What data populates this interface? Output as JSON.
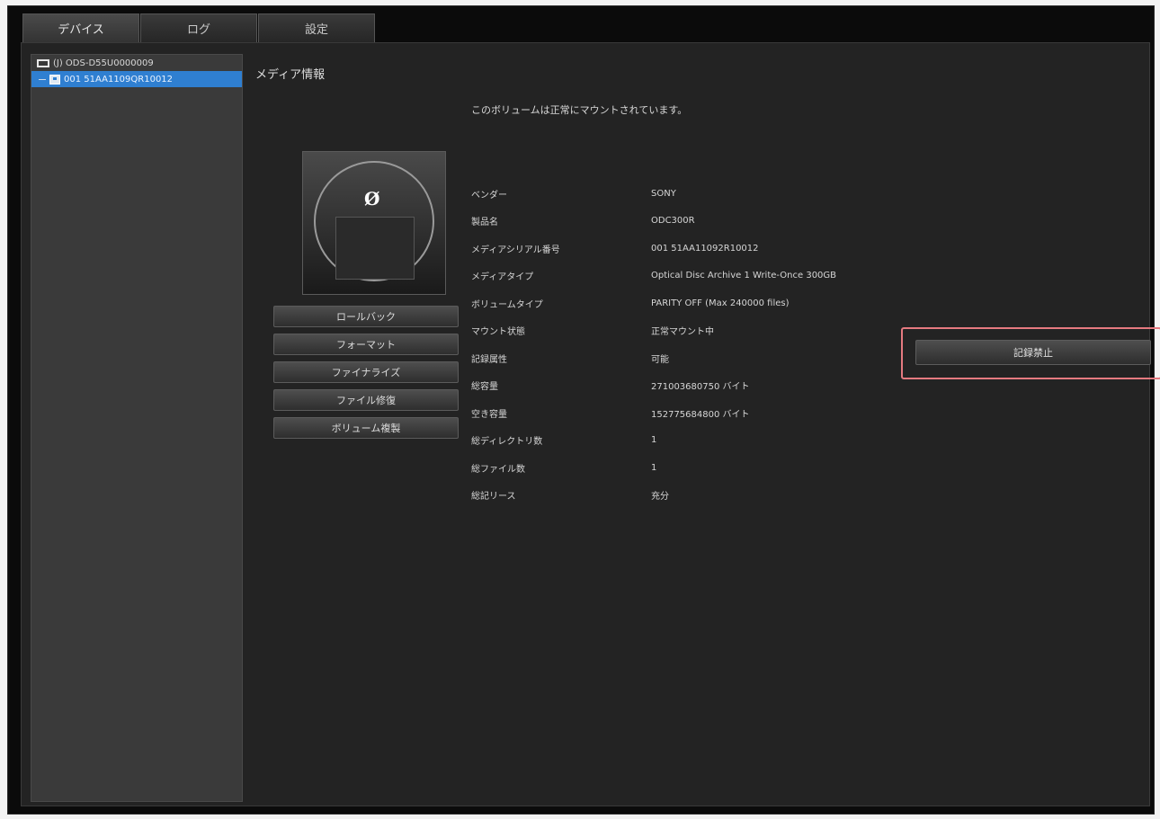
{
  "tabs": [
    {
      "label": "デバイス"
    },
    {
      "label": "ログ"
    },
    {
      "label": "設定"
    }
  ],
  "sidebar": {
    "device": {
      "label": "(J) ODS-D55U0000009"
    },
    "media": {
      "label": "001 51AA1109QR10012"
    }
  },
  "section_title": "メディア情報",
  "mount_message": "このボリュームは正常にマウントされています。",
  "actions": [
    {
      "label": "ロールバック"
    },
    {
      "label": "フォーマット"
    },
    {
      "label": "ファイナライズ"
    },
    {
      "label": "ファイル修復"
    },
    {
      "label": "ボリューム複製"
    }
  ],
  "info": [
    {
      "label": "ベンダー",
      "value": "SONY"
    },
    {
      "label": "製品名",
      "value": "ODC300R"
    },
    {
      "label": "メディアシリアル番号",
      "value": "001 51AA11092R10012"
    },
    {
      "label": "メディアタイプ",
      "value": "Optical Disc Archive 1 Write-Once 300GB"
    },
    {
      "label": "ボリュームタイプ",
      "value": "PARITY OFF (Max 240000 files)"
    },
    {
      "label": "マウント状態",
      "value": "正常マウント中"
    },
    {
      "label": "記録属性",
      "value": "可能"
    },
    {
      "label": "総容量",
      "value": "271003680750 バイト"
    },
    {
      "label": "空き容量",
      "value": "152775684800 バイト"
    },
    {
      "label": "総ディレクトリ数",
      "value": "1"
    },
    {
      "label": "総ファイル数",
      "value": "1"
    },
    {
      "label": "総記リース",
      "value": "充分"
    }
  ],
  "stop_button": {
    "label": "記録禁止"
  },
  "colors": {
    "highlight": "#e57a80",
    "selection": "#2f7fd1"
  }
}
